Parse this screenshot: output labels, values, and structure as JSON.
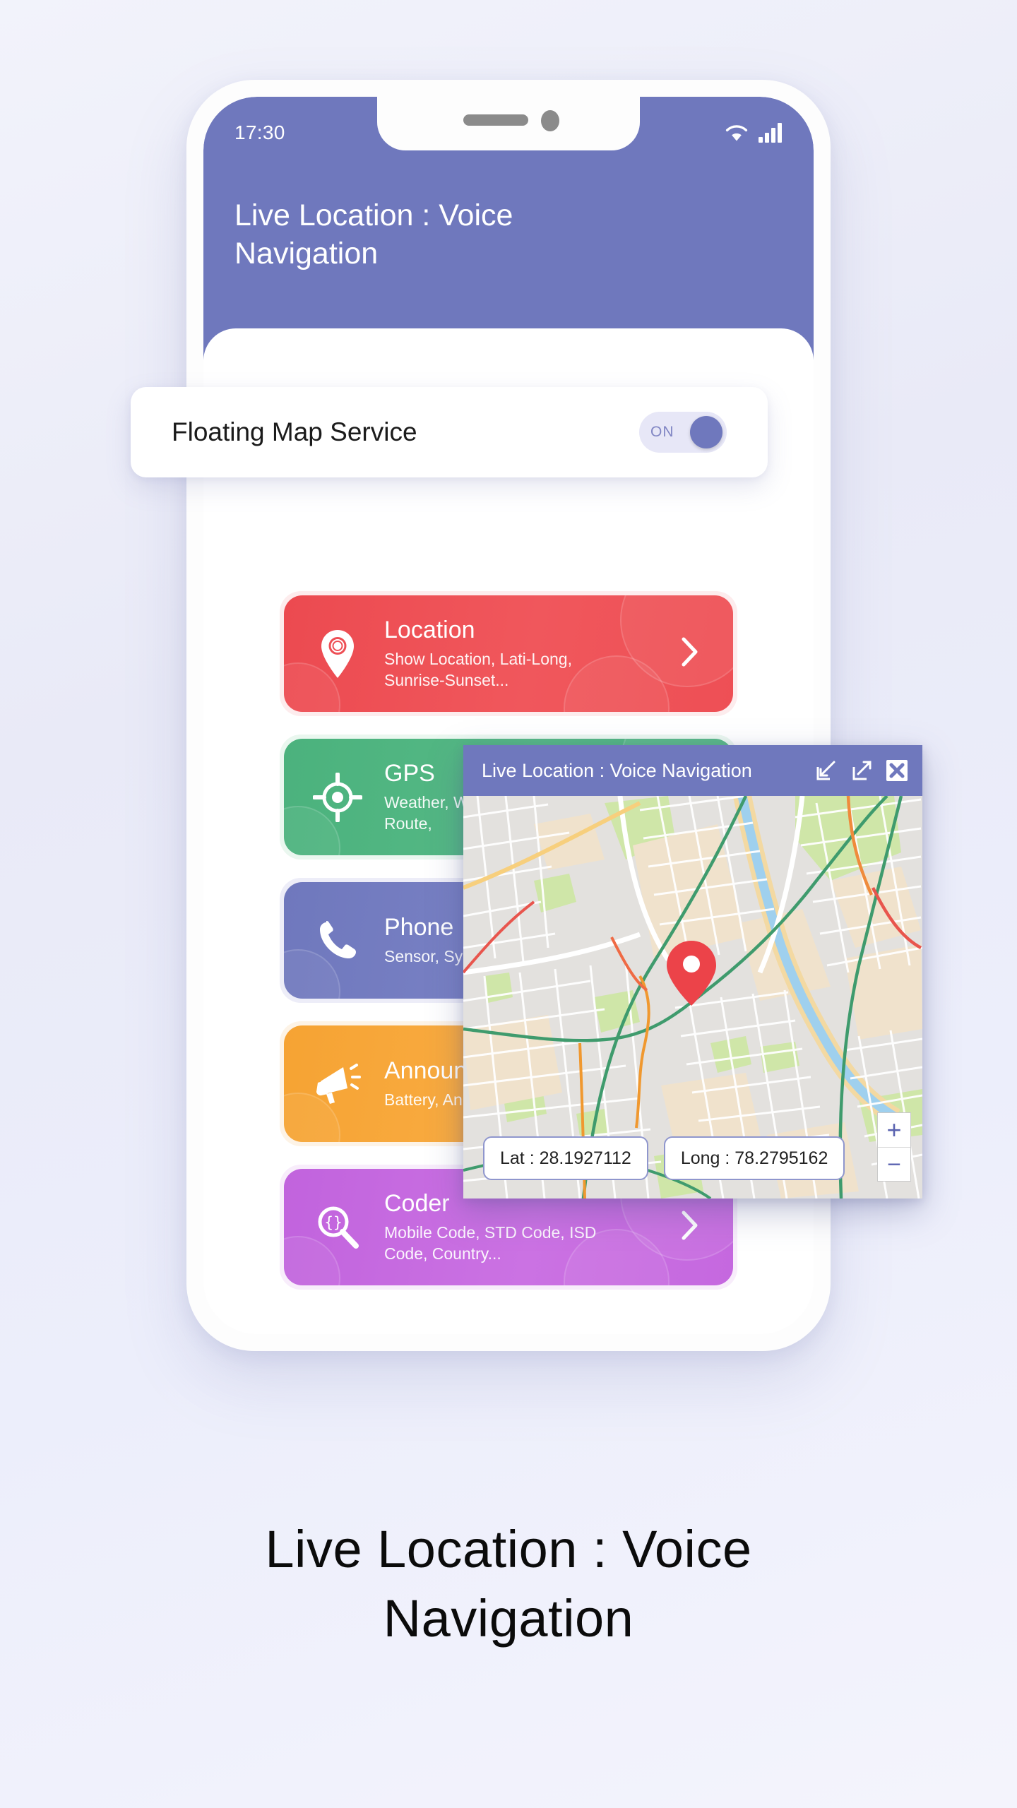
{
  "status_bar": {
    "time": "17:30",
    "wifi_icon": "wifi-icon",
    "signal_icon": "signal-bars-icon"
  },
  "header": {
    "title": "Live Location : Voice Navigation",
    "background_color": "#6F78BD"
  },
  "floating_service": {
    "label": "Floating Map Service",
    "toggle_state": "ON",
    "toggle_color": "#6F78BD",
    "toggle_track_color": "#E7E7F7"
  },
  "menu_cards": [
    {
      "title": "Location",
      "subtitle": "Show Location, Lati-Long, Sunrise-Sunset...",
      "icon": "map-pin-icon",
      "color": "#EE4F55",
      "chevron": "chevron-right-icon"
    },
    {
      "title": "GPS",
      "subtitle": "Weather, World Clock, GPS Route,",
      "icon": "gps-target-icon",
      "color": "#4EB480",
      "chevron": "chevron-right-icon"
    },
    {
      "title": "Phone",
      "subtitle": "Sensor, System",
      "icon": "phone-icon",
      "color": "#6F78BD",
      "chevron": "chevron-right-icon"
    },
    {
      "title": "Announ",
      "subtitle": "Battery, Announ",
      "icon": "megaphone-icon",
      "color": "#F7A63A",
      "chevron": "chevron-right-icon"
    },
    {
      "title": "Coder",
      "subtitle": "Mobile Code, STD Code, ISD Code, Country...",
      "icon": "code-search-icon",
      "color": "#C568DF",
      "chevron": "chevron-right-icon"
    }
  ],
  "floating_window": {
    "title": "Live Location : Voice Navigation",
    "controls": {
      "minimize": "minimize-icon",
      "expand": "expand-icon",
      "close": "close-icon"
    },
    "map": {
      "marker": "map-marker-icon",
      "latitude_label": "Lat : 28.1927112",
      "longitude_label": "Long : 78.2795162",
      "zoom_in": "+",
      "zoom_out": "−"
    }
  },
  "caption": {
    "line1": "Live Location : Voice",
    "line2": "Navigation"
  }
}
